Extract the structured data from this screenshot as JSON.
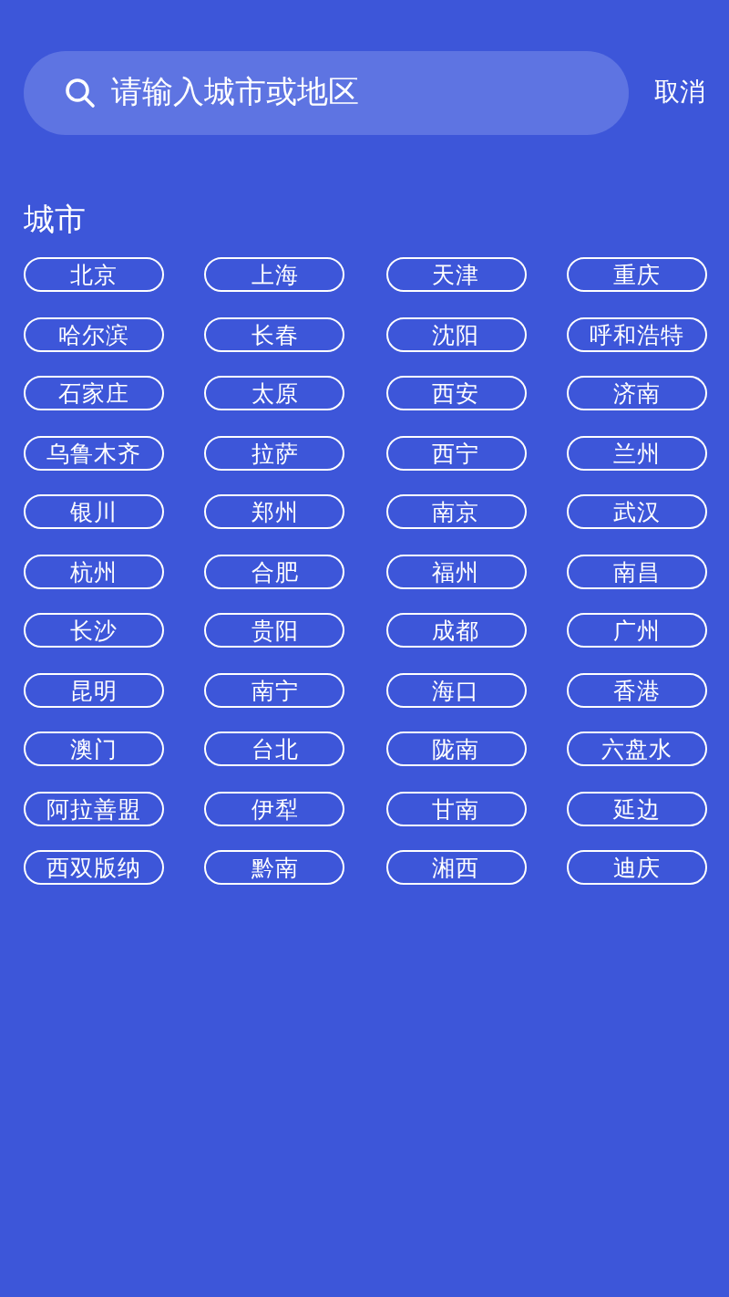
{
  "search": {
    "placeholder": "请输入城市或地区"
  },
  "cancel": "取消",
  "section_title": "城市",
  "cities": [
    "北京",
    "上海",
    "天津",
    "重庆",
    "哈尔滨",
    "长春",
    "沈阳",
    "呼和浩特",
    "石家庄",
    "太原",
    "西安",
    "济南",
    "乌鲁木齐",
    "拉萨",
    "西宁",
    "兰州",
    "银川",
    "郑州",
    "南京",
    "武汉",
    "杭州",
    "合肥",
    "福州",
    "南昌",
    "长沙",
    "贵阳",
    "成都",
    "广州",
    "昆明",
    "南宁",
    "海口",
    "香港",
    "澳门",
    "台北",
    "陇南",
    "六盘水",
    "阿拉善盟",
    "伊犁",
    "甘南",
    "延边",
    "西双版纳",
    "黔南",
    "湘西",
    "迪庆"
  ]
}
